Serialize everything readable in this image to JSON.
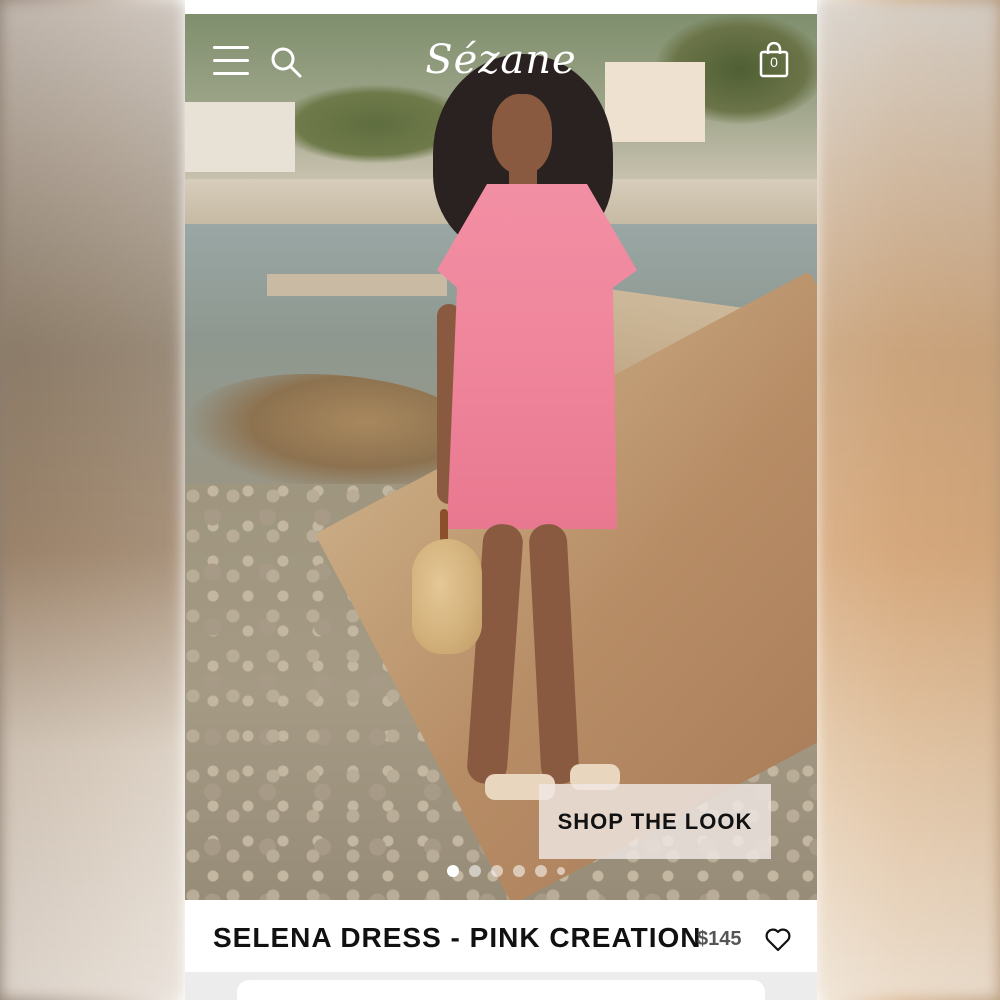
{
  "header": {
    "logo": "Sézane",
    "menu_icon": "hamburger-menu-icon",
    "search_icon": "search-icon",
    "cart_icon": "shopping-bag-icon",
    "cart_count": "0"
  },
  "hero": {
    "cta_label": "SHOP THE LOOK",
    "carousel_total": 6,
    "carousel_active": 1
  },
  "product": {
    "name": "SELENA DRESS - PINK CREATION",
    "price": "$145",
    "wishlist_icon": "heart-icon"
  },
  "colors": {
    "dress": "#f28fa4",
    "text": "#111111",
    "price": "#555555",
    "overlay_button": "#f0e8e4"
  }
}
